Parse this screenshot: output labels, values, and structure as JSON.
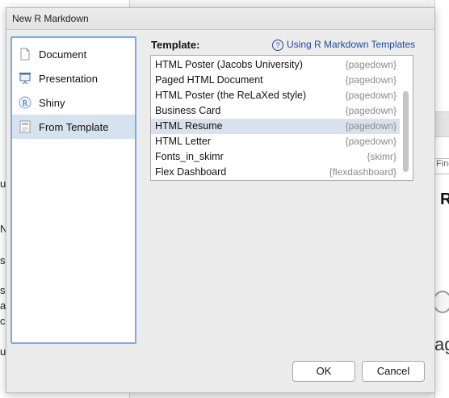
{
  "background": {
    "left_fragments": [
      "u",
      "N",
      "s",
      "s",
      "a",
      "c",
      "u"
    ],
    "find_text": "Find",
    "big_text": "R",
    "bottom_text": "ag"
  },
  "dialog": {
    "title": "New R Markdown",
    "types": [
      {
        "label": "Document",
        "icon": "document-icon"
      },
      {
        "label": "Presentation",
        "icon": "presentation-icon"
      },
      {
        "label": "Shiny",
        "icon": "shiny-icon"
      },
      {
        "label": "From Template",
        "icon": "template-icon"
      }
    ],
    "selected_type": "From Template",
    "template_label": "Template:",
    "help_link": "Using R Markdown Templates",
    "templates": [
      {
        "name": "HTML Poster (Jacobs University)",
        "package": "{pagedown}"
      },
      {
        "name": "Paged HTML Document",
        "package": "{pagedown}"
      },
      {
        "name": "HTML Poster (the ReLaXed style)",
        "package": "{pagedown}"
      },
      {
        "name": "Business Card",
        "package": "{pagedown}"
      },
      {
        "name": "HTML Resume",
        "package": "{pagedown}"
      },
      {
        "name": "HTML Letter",
        "package": "{pagedown}"
      },
      {
        "name": "Fonts_in_skimr",
        "package": "{skimr}"
      },
      {
        "name": "Flex Dashboard",
        "package": "{flexdashboard}"
      }
    ],
    "selected_template": "HTML Resume",
    "ok_label": "OK",
    "cancel_label": "Cancel"
  },
  "colors": {
    "accent_border": "#7fa9e6",
    "selected_row": "#d9e2ec",
    "link": "#1d4ba0"
  }
}
